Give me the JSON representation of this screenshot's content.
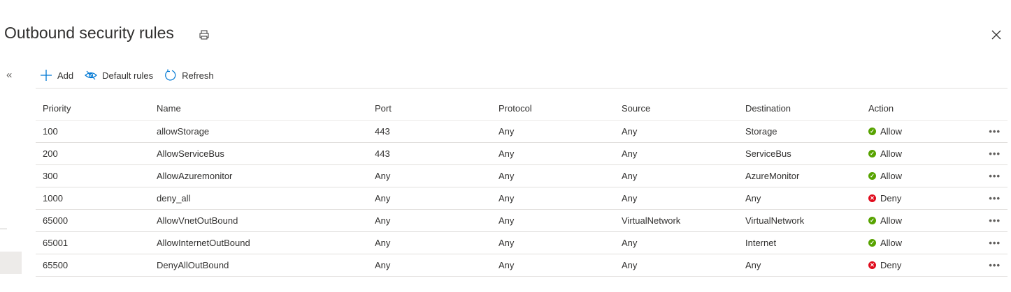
{
  "header": {
    "title": "Outbound security rules"
  },
  "toolbar": {
    "add": "Add",
    "default_rules": "Default rules",
    "refresh": "Refresh"
  },
  "columns": [
    "Priority",
    "Name",
    "Port",
    "Protocol",
    "Source",
    "Destination",
    "Action"
  ],
  "colors": {
    "allow": "#57a300",
    "deny": "#e00b1c"
  },
  "rows": [
    {
      "priority": "100",
      "name": "allowStorage",
      "port": "443",
      "protocol": "Any",
      "source": "Any",
      "destination": "Storage",
      "action": "Allow"
    },
    {
      "priority": "200",
      "name": "AllowServiceBus",
      "port": "443",
      "protocol": "Any",
      "source": "Any",
      "destination": "ServiceBus",
      "action": "Allow"
    },
    {
      "priority": "300",
      "name": "AllowAzuremonitor",
      "port": "Any",
      "protocol": "Any",
      "source": "Any",
      "destination": "AzureMonitor",
      "action": "Allow"
    },
    {
      "priority": "1000",
      "name": "deny_all",
      "port": "Any",
      "protocol": "Any",
      "source": "Any",
      "destination": "Any",
      "action": "Deny"
    },
    {
      "priority": "65000",
      "name": "AllowVnetOutBound",
      "port": "Any",
      "protocol": "Any",
      "source": "VirtualNetwork",
      "destination": "VirtualNetwork",
      "action": "Allow"
    },
    {
      "priority": "65001",
      "name": "AllowInternetOutBound",
      "port": "Any",
      "protocol": "Any",
      "source": "Any",
      "destination": "Internet",
      "action": "Allow"
    },
    {
      "priority": "65500",
      "name": "DenyAllOutBound",
      "port": "Any",
      "protocol": "Any",
      "source": "Any",
      "destination": "Any",
      "action": "Deny"
    }
  ]
}
